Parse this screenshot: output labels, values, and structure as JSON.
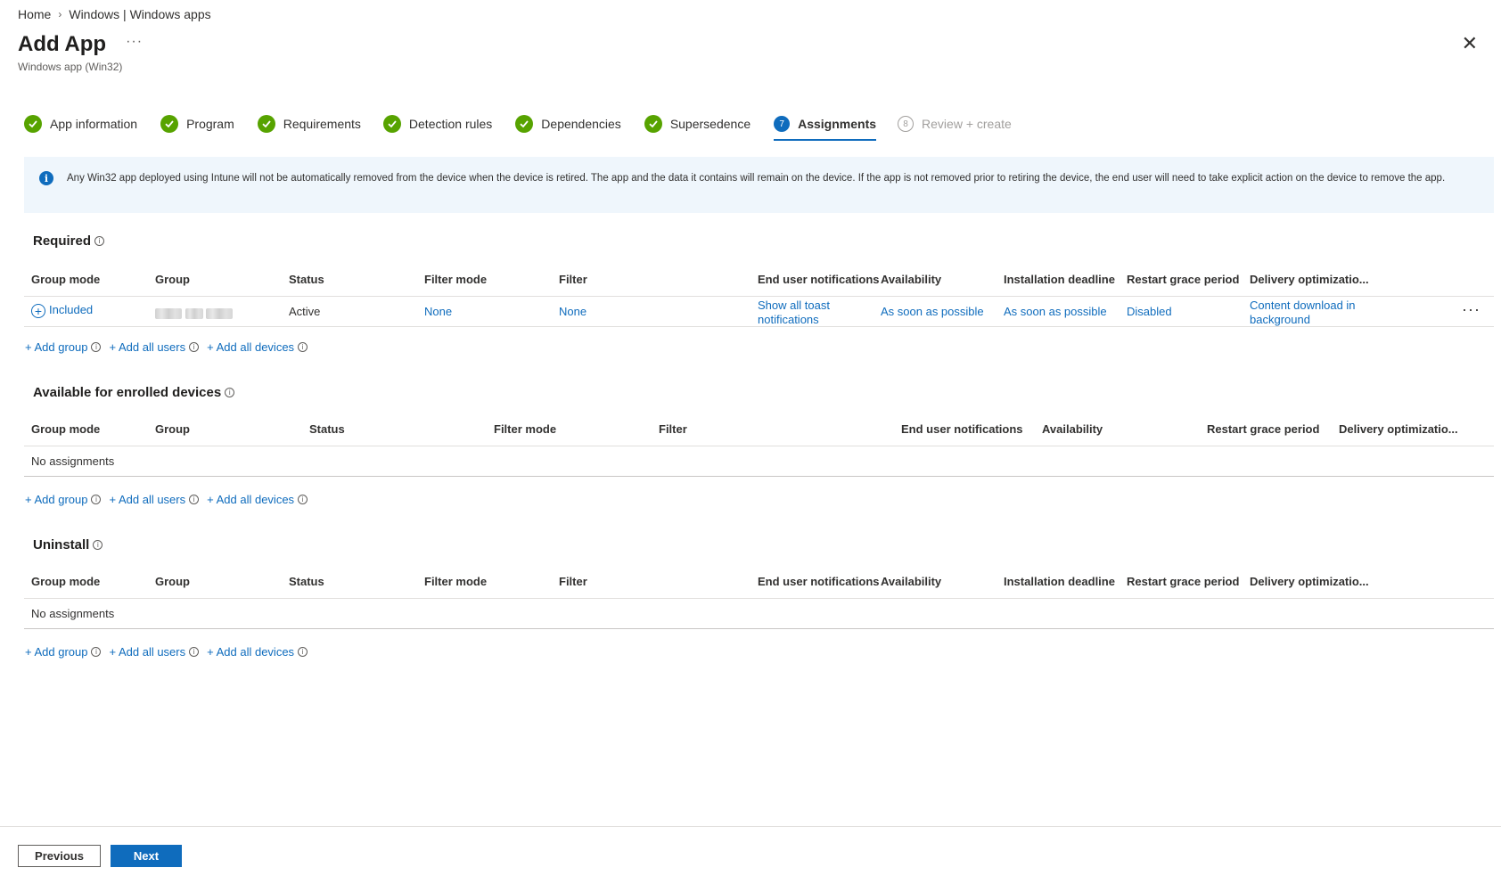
{
  "breadcrumb": [
    "Home",
    "Windows | Windows apps"
  ],
  "header": {
    "title": "Add App",
    "subtitle": "Windows app (Win32)",
    "more": "···",
    "close": "✕"
  },
  "steps": [
    {
      "label": "App information",
      "state": "done"
    },
    {
      "label": "Program",
      "state": "done"
    },
    {
      "label": "Requirements",
      "state": "done"
    },
    {
      "label": "Detection rules",
      "state": "done"
    },
    {
      "label": "Dependencies",
      "state": "done"
    },
    {
      "label": "Supersedence",
      "state": "done"
    },
    {
      "label": "Assignments",
      "state": "current",
      "number": "7"
    },
    {
      "label": "Review + create",
      "state": "future",
      "number": "8"
    }
  ],
  "info_banner": "Any Win32 app deployed using Intune will not be automatically removed from the device when the device is retired. The app and the data it contains will remain on the device. If the app is not removed prior to retiring the device, the end user will need to take explicit action on the device to remove the app.",
  "add_links": {
    "add_group": "+ Add group",
    "add_all_users": "+ Add all users",
    "add_all_devices": "+ Add all devices"
  },
  "required": {
    "title": "Required",
    "columns": [
      "Group mode",
      "Group",
      "Status",
      "Filter mode",
      "Filter",
      "End user notifications",
      "Availability",
      "Installation deadline",
      "Restart grace period",
      "Delivery optimizatio..."
    ],
    "row": {
      "group_mode": "Included",
      "status": "Active",
      "filter_mode": "None",
      "filter": "None",
      "notifications": "Show all toast notifications",
      "availability": "As soon as possible",
      "deadline": "As soon as possible",
      "restart": "Disabled",
      "delivery": "Content download in background"
    }
  },
  "available": {
    "title": "Available for enrolled devices",
    "columns": [
      "Group mode",
      "Group",
      "Status",
      "Filter mode",
      "Filter",
      "End user notifications",
      "Availability",
      "Restart grace period",
      "Delivery optimizatio..."
    ],
    "empty": "No assignments"
  },
  "uninstall": {
    "title": "Uninstall",
    "columns": [
      "Group mode",
      "Group",
      "Status",
      "Filter mode",
      "Filter",
      "End user notifications",
      "Availability",
      "Installation deadline",
      "Restart grace period",
      "Delivery optimizatio..."
    ],
    "empty": "No assignments"
  },
  "footer": {
    "previous": "Previous",
    "next": "Next"
  }
}
